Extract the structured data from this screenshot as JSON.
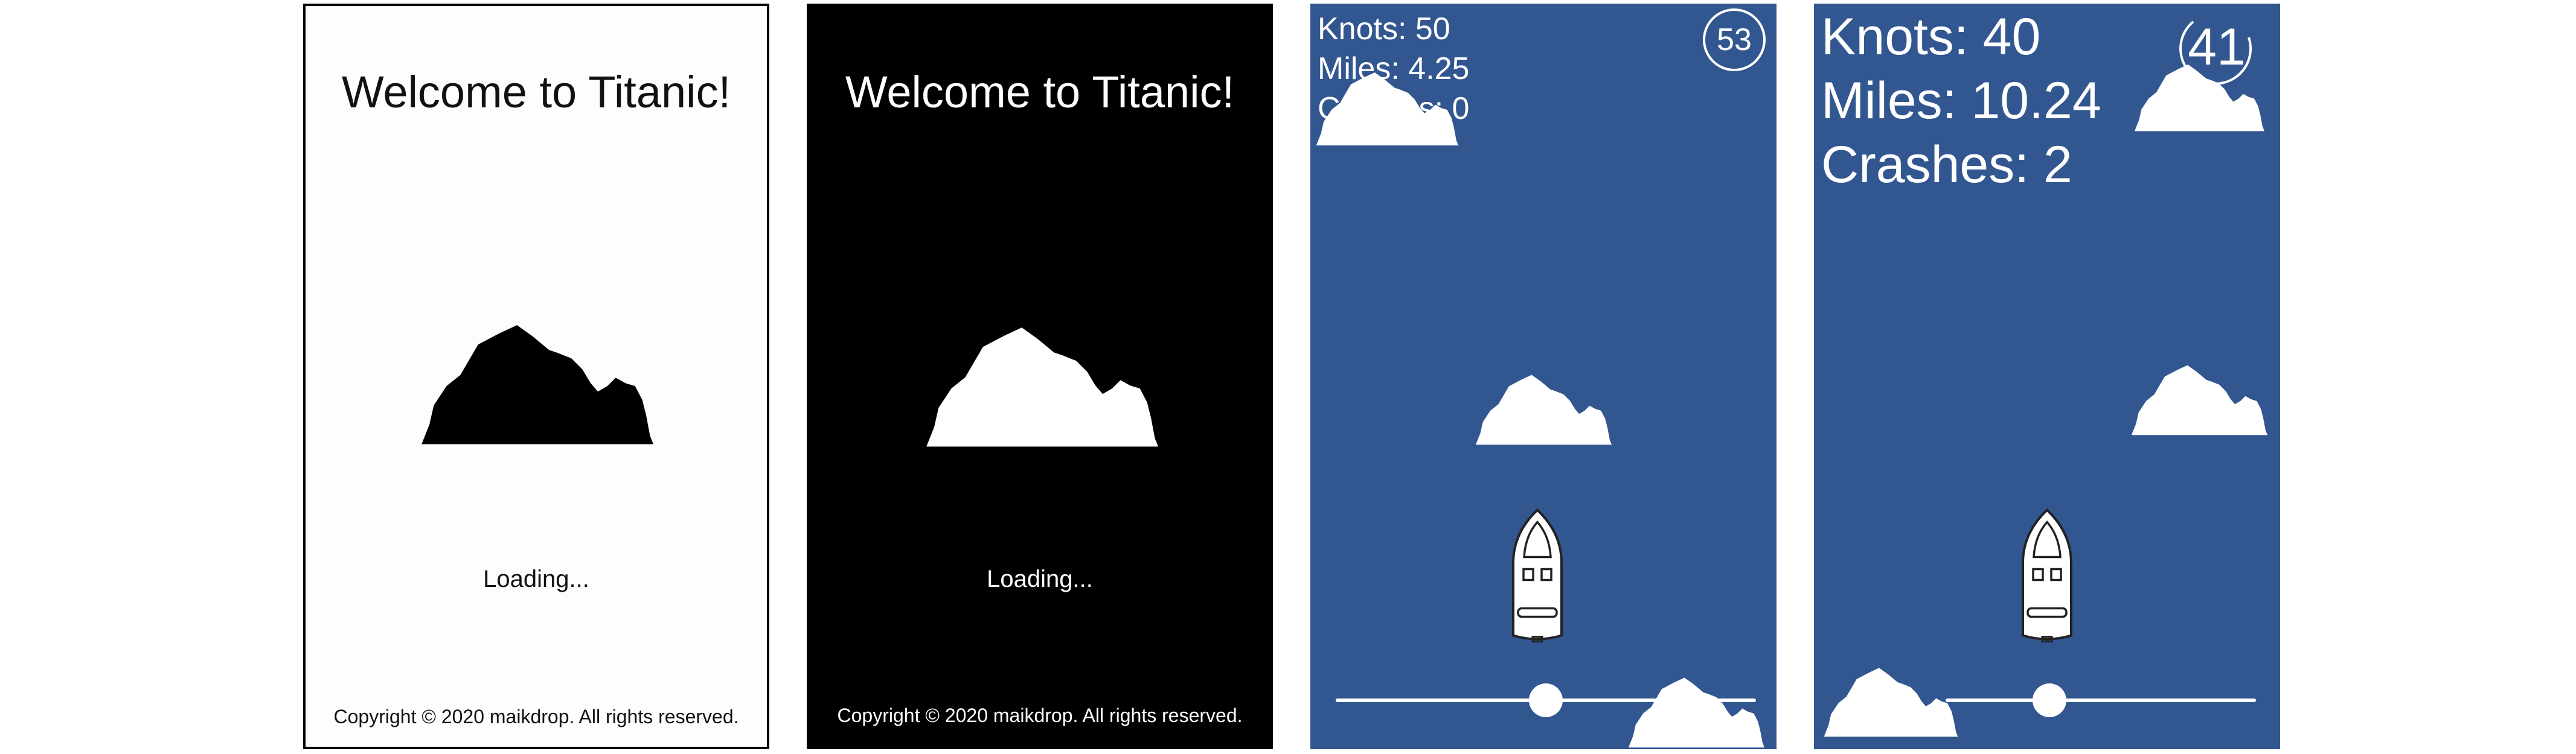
{
  "splash_light": {
    "title": "Welcome to Titanic!",
    "loading": "Loading...",
    "copyright": "Copyright © 2020 maikdrop. All rights reserved."
  },
  "splash_dark": {
    "title": "Welcome to Titanic!",
    "loading": "Loading...",
    "copyright": "Copyright © 2020 maikdrop. All rights reserved."
  },
  "game_small": {
    "knots": "Knots: 50",
    "miles": "Miles: 4.25",
    "crashes": "Crashes: 0",
    "timer": "53",
    "speed_slider_fraction": 0.5
  },
  "game_large": {
    "knots": "Knots: 40",
    "miles": "Miles: 10.24",
    "crashes": "Crashes: 2",
    "timer": "41",
    "speed_slider_fraction": 0.5
  },
  "colors": {
    "ocean": "#325790",
    "ice": "#ffffff",
    "dark_bg": "#000000"
  }
}
